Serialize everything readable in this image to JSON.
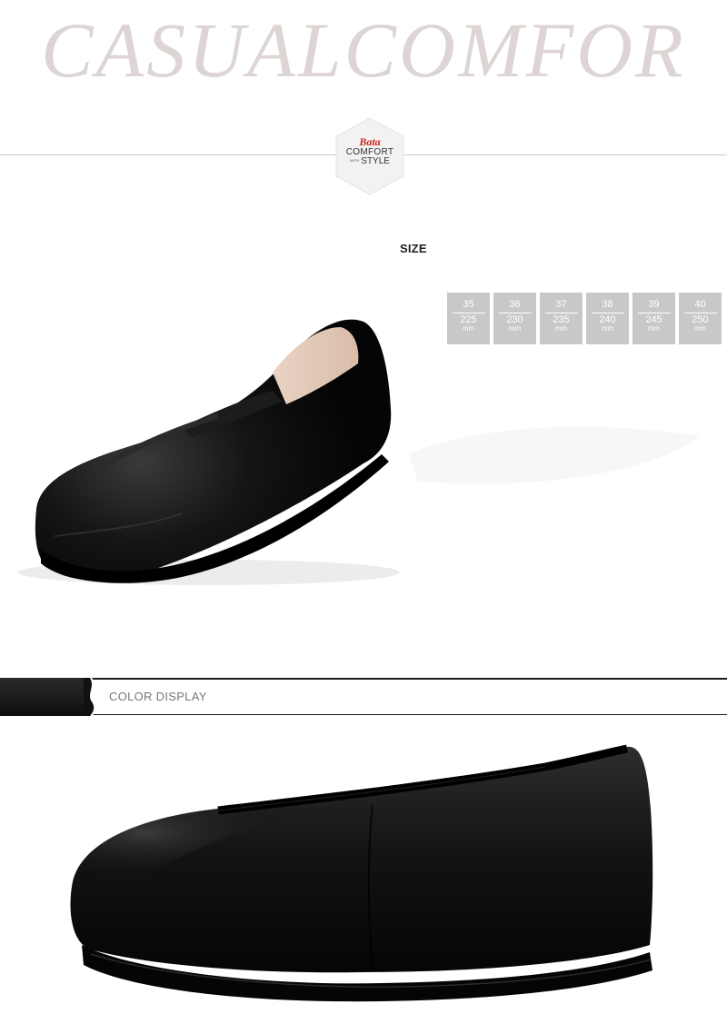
{
  "hero": {
    "title": "CASUALCOMFOR"
  },
  "logo": {
    "brand": "Bata",
    "line1": "COMFORT",
    "small": "WITH",
    "line2": "STYLE"
  },
  "size_section": {
    "heading": "SIZE",
    "sizes": [
      {
        "eu": "35",
        "mm": "225",
        "unit": "mm"
      },
      {
        "eu": "36",
        "mm": "230",
        "unit": "mm"
      },
      {
        "eu": "37",
        "mm": "235",
        "unit": "mm"
      },
      {
        "eu": "38",
        "mm": "240",
        "unit": "mm"
      },
      {
        "eu": "39",
        "mm": "245",
        "unit": "mm"
      },
      {
        "eu": "40",
        "mm": "250",
        "unit": "mm"
      }
    ]
  },
  "color_display": {
    "label": "COLOR  DISPLAY"
  },
  "colors": {
    "title": "#ddd5d3",
    "brand": "#d0241b",
    "size_cell": "#c8c8c8",
    "shoe": "#111111"
  }
}
